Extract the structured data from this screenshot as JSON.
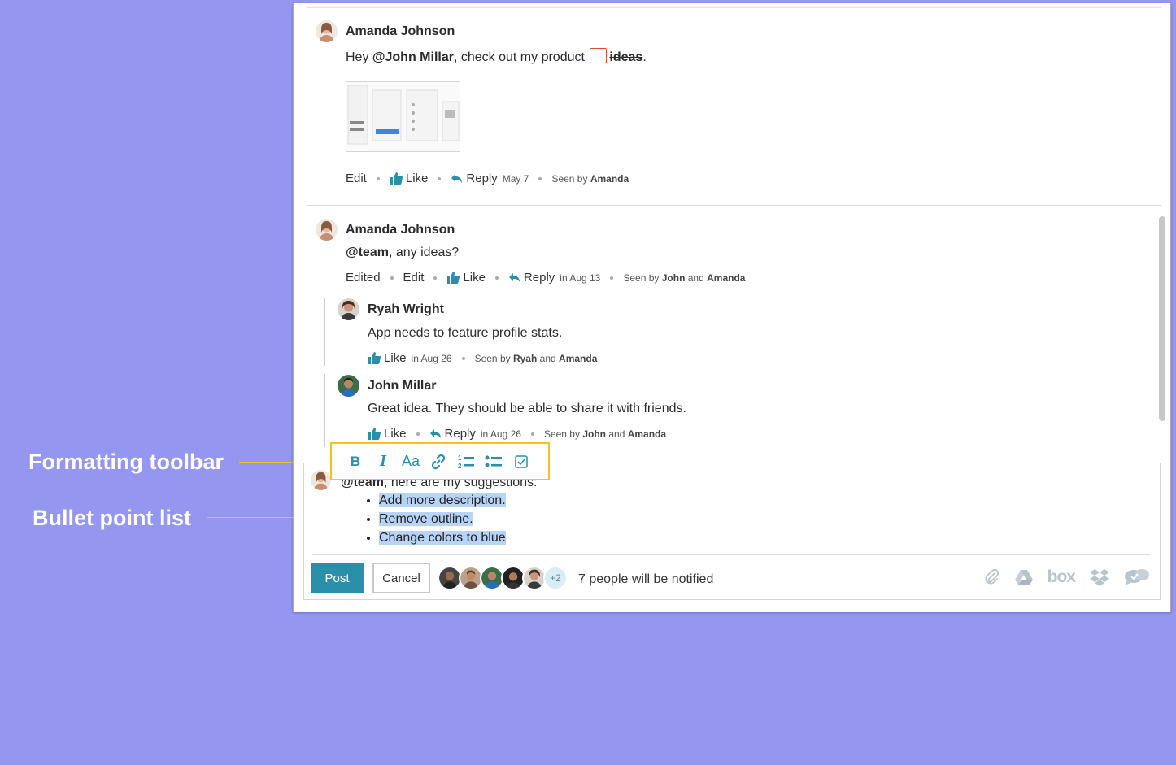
{
  "callouts": {
    "formatting": "Formatting toolbar",
    "bullets": "Bullet point list"
  },
  "comments": [
    {
      "author": "Amanda Johnson",
      "text_prefix": "Hey ",
      "mention": "@John Millar",
      "text_mid": ", check out my product",
      "strike_word": "ideas",
      "text_suffix": ".",
      "actions": {
        "edit": "Edit",
        "like": "Like",
        "reply": "Reply",
        "date": "May 7",
        "seen_prefix": "Seen by",
        "seen_names": "Amanda"
      }
    },
    {
      "author": "Amanda Johnson",
      "mention": "@team",
      "text": ", any ideas?",
      "actions": {
        "edited": "Edited",
        "edit": "Edit",
        "like": "Like",
        "reply": "Reply",
        "date": "in Aug 13",
        "seen_prefix": "Seen by",
        "seen_name1": "John",
        "seen_and": "and",
        "seen_name2": "Amanda"
      },
      "replies": [
        {
          "author": "Ryah Wright",
          "text": "App needs to feature profile stats.",
          "actions": {
            "like": "Like",
            "date": "in Aug 26",
            "seen_prefix": "Seen by",
            "seen_name1": "Ryah",
            "seen_and": "and",
            "seen_name2": "Amanda"
          }
        },
        {
          "author": "John Millar",
          "text": "Great idea. They should be able to share it with friends.",
          "actions": {
            "like": "Like",
            "reply": "Reply",
            "date": "in Aug 26",
            "seen_prefix": "Seen by",
            "seen_name1": "John",
            "seen_and": "and",
            "seen_name2": "Amanda"
          }
        }
      ]
    }
  ],
  "composer": {
    "mention": "@team",
    "intro": ", here are my suggestions:",
    "bullets": [
      "Add more description.",
      "Remove outline.",
      "Change colors to blue"
    ],
    "post_label": "Post",
    "cancel_label": "Cancel",
    "extra_count": "+2",
    "notify_text": "7 people will be notified"
  },
  "toolbar": {
    "bold": "B",
    "italic": "I",
    "font_size": "Aa",
    "icons": [
      "bold-icon",
      "italic-icon",
      "font-size-icon",
      "link-icon",
      "numbered-list-icon",
      "bullet-list-icon",
      "checkbox-icon"
    ]
  },
  "integrations": [
    "paperclip-icon",
    "google-drive-icon",
    "box",
    "dropbox-icon",
    "chat-icon"
  ],
  "colors": {
    "accent": "#2a8fa8",
    "highlight": "#f5c11a",
    "background": "#9596ef",
    "selection": "#b7d3f6"
  }
}
